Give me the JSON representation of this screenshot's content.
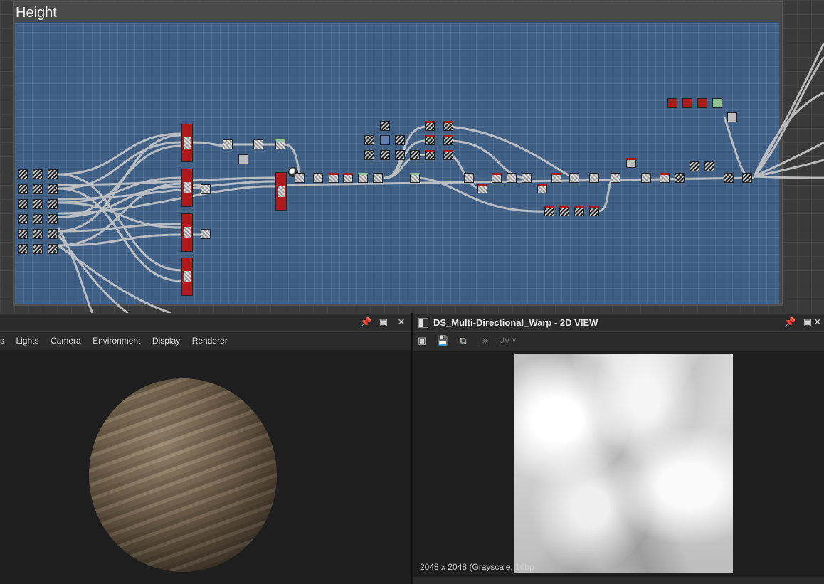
{
  "graph": {
    "frame_title": "Height"
  },
  "panel3d": {
    "menu": [
      "s",
      "Lights",
      "Camera",
      "Environment",
      "Display",
      "Renderer"
    ],
    "icons": {
      "pin": "pin-icon",
      "maximize": "maximize-icon",
      "close": "close-icon"
    }
  },
  "panel2d": {
    "title": "DS_Multi-Directional_Warp - 2D VIEW",
    "uv_label": "UV",
    "image_info": "2048 x 2048 (Grayscale, 16bp",
    "toolbar_icons": [
      "fit-view-icon",
      "save-icon",
      "copy-icon",
      "share-icon"
    ],
    "icons": {
      "pin": "pin-icon",
      "maximize": "maximize-icon",
      "close": "close-icon"
    }
  },
  "colors": {
    "frame_blue": "#3f5f84",
    "node_red": "#b01a1a",
    "panel_bg": "#1e1e1e"
  }
}
